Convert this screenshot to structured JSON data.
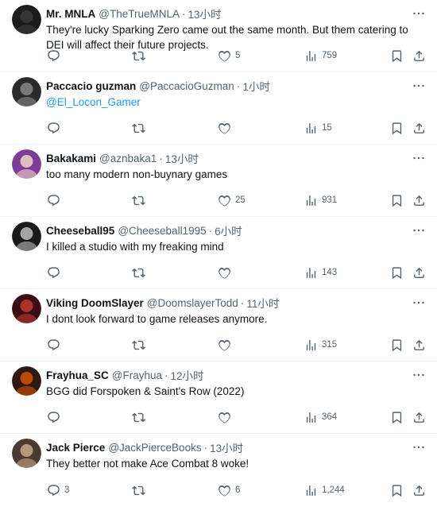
{
  "tweets": [
    {
      "name": "Mr. MNLA",
      "handle": "@TheTrueMNLA",
      "dot": "·",
      "time": "13小时",
      "text": "They're lucky Sparking Zero came out the same month. But them catering to DEI will affect their future projects.",
      "is_link": false,
      "replies": "",
      "retweets": "",
      "likes": "5",
      "views": "759",
      "avatar_colors": [
        "#1c1c1c",
        "#3a3a3a"
      ]
    },
    {
      "name": "Paccacio guzman",
      "handle": "@PaccacioGuzman",
      "dot": "·",
      "time": "1小时",
      "text": "@El_Locon_Gamer",
      "is_link": true,
      "replies": "",
      "retweets": "",
      "likes": "",
      "views": "15",
      "avatar_colors": [
        "#2b2b2b",
        "#8a8a8a"
      ]
    },
    {
      "name": "Bakakami",
      "handle": "@aznbaka1",
      "dot": "·",
      "time": "13小时",
      "text": "too many modern non-buynary games",
      "is_link": false,
      "replies": "",
      "retweets": "",
      "likes": "25",
      "views": "931",
      "avatar_colors": [
        "#7d3c98",
        "#f3d3c4"
      ]
    },
    {
      "name": "Cheeseball95",
      "handle": "@Cheeseball1995",
      "dot": "·",
      "time": "6小时",
      "text": "I killed a studio with my freaking mind",
      "is_link": false,
      "replies": "",
      "retweets": "",
      "likes": "",
      "views": "143",
      "avatar_colors": [
        "#1a1a1a",
        "#bdbdbd"
      ]
    },
    {
      "name": "Viking DoomSlayer",
      "handle": "@DoomslayerTodd",
      "dot": "·",
      "time": "11小时",
      "text": "I dont look forward to game releases anymore.",
      "is_link": false,
      "replies": "",
      "retweets": "",
      "likes": "",
      "views": "315",
      "avatar_colors": [
        "#3b0d14",
        "#c0392b"
      ]
    },
    {
      "name": "Frayhua_SC",
      "handle": "@Frayhua",
      "dot": "·",
      "time": "12小时",
      "text": "BGG did Forspoken & Saint's Row (2022)",
      "is_link": false,
      "replies": "",
      "retweets": "",
      "likes": "",
      "views": "364",
      "avatar_colors": [
        "#2e1a12",
        "#d35400"
      ]
    },
    {
      "name": "Jack Pierce",
      "handle": "@JackPierceBooks",
      "dot": "·",
      "time": "13小时",
      "text": "They better not make Ace Combat 8 woke!",
      "is_link": false,
      "replies": "3",
      "retweets": "",
      "likes": "6",
      "views": "1,244",
      "avatar_colors": [
        "#4a3b30",
        "#c9a98a"
      ]
    }
  ]
}
